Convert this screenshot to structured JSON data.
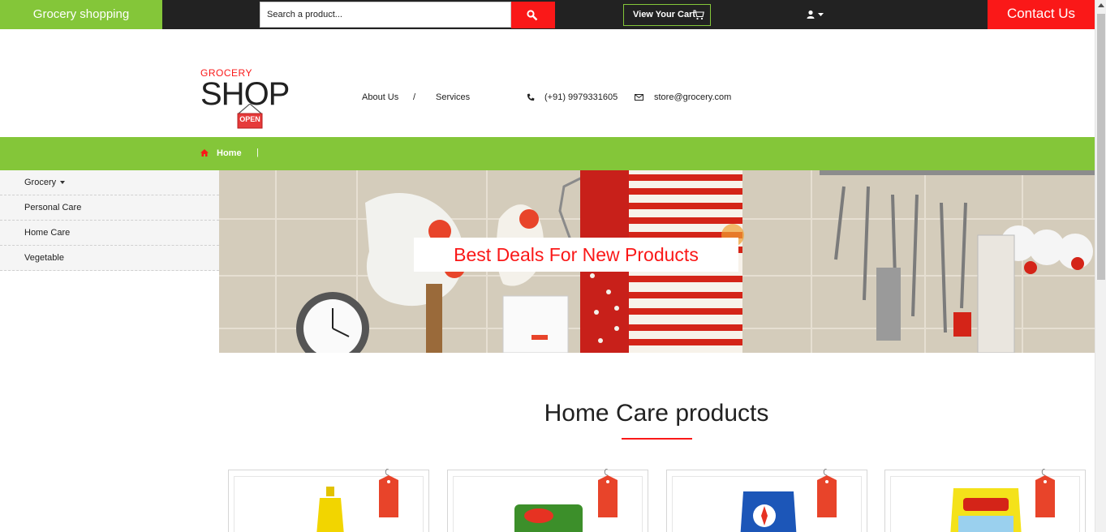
{
  "topbar": {
    "brand": "Grocery shopping",
    "search_placeholder": "Search a product...",
    "cart_label": "View Your Cart",
    "contact_label": "Contact Us"
  },
  "header": {
    "logo_small": "GROCERY",
    "logo_big": "SHOP",
    "logo_sign": "OPEN",
    "nav": [
      {
        "label": "About Us"
      },
      {
        "label": "Services"
      }
    ],
    "nav_separator": "/",
    "phone": "(+91) 9979331605",
    "email": "store@grocery.com"
  },
  "breadcrumb": {
    "home": "Home",
    "separator": "|"
  },
  "sidebar": {
    "items": [
      {
        "label": "Grocery"
      },
      {
        "label": "Personal Care"
      },
      {
        "label": "Home Care"
      },
      {
        "label": "Vegetable"
      }
    ]
  },
  "banner": {
    "tagline": "Best Deals For New Products"
  },
  "section": {
    "title": "Home Care products"
  },
  "colors": {
    "green": "#84c639",
    "red": "#fa1818",
    "dark": "#222222"
  },
  "icons": {
    "search": "search-icon",
    "cart": "cart-icon",
    "user": "user-icon",
    "phone": "phone-icon",
    "email": "envelope-icon",
    "home": "home-icon"
  }
}
